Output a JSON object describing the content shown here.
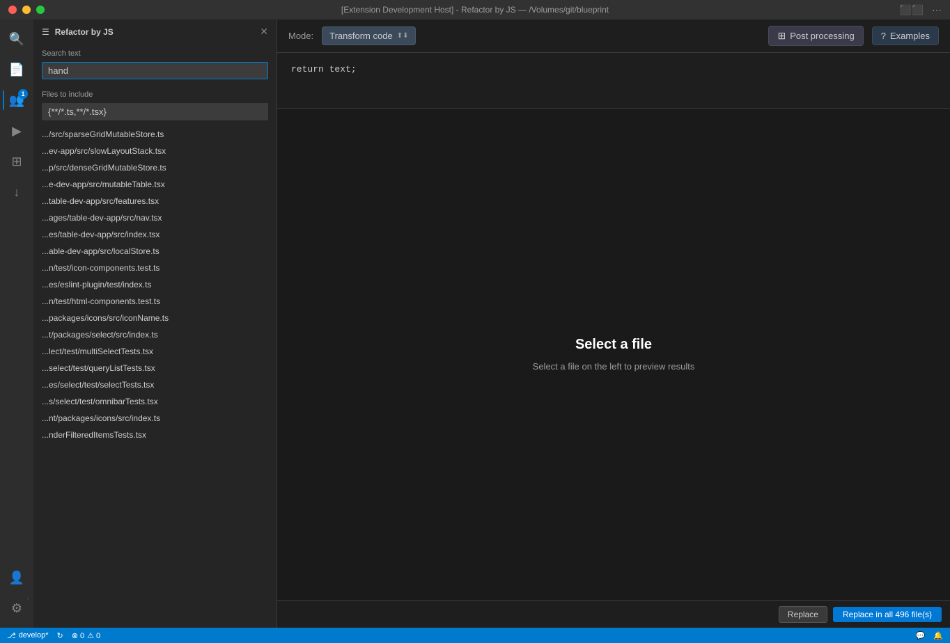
{
  "titlebar": {
    "title": "[Extension Development Host] - Refactor by JS — /Volumes/git/blueprint"
  },
  "panel": {
    "header_icon": "☰",
    "title": "Refactor by JS",
    "close_label": "✕",
    "search_label": "Search text",
    "search_value": "hand",
    "files_label": "Files to include",
    "files_value": "{**/*.ts,**/*.tsx}",
    "file_list": [
      ".../src/sparseGridMutableStore.ts",
      "...ev-app/src/slowLayoutStack.tsx",
      "...p/src/denseGridMutableStore.ts",
      "...e-dev-app/src/mutableTable.tsx",
      "...table-dev-app/src/features.tsx",
      "...ages/table-dev-app/src/nav.tsx",
      "...es/table-dev-app/src/index.tsx",
      "...able-dev-app/src/localStore.ts",
      "...n/test/icon-components.test.ts",
      "...es/eslint-plugin/test/index.ts",
      "...n/test/html-components.test.ts",
      "...packages/icons/src/iconName.ts",
      "...t/packages/select/src/index.ts",
      "...lect/test/multiSelectTests.tsx",
      "...select/test/queryListTests.tsx",
      "...es/select/test/selectTests.tsx",
      "...s/select/test/omnibarTests.tsx",
      "...nt/packages/icons/src/index.ts",
      "...nderFilteredItemsTests.tsx"
    ]
  },
  "toolbar": {
    "mode_label": "Mode:",
    "mode_value": "Transform code",
    "mode_arrow": "⬆⬇",
    "post_processing_label": "Post processing",
    "examples_label": "Examples"
  },
  "code": {
    "content": "return text;"
  },
  "preview": {
    "title": "Select a file",
    "subtitle": "Select a file on the left to preview results"
  },
  "bottom_bar": {
    "replace_label": "Replace",
    "replace_all_label": "Replace in all 496 file(s)"
  },
  "status_bar": {
    "branch": "develop*",
    "sync_icon": "↻",
    "errors": "⊗ 0",
    "warnings": "⚠ 0",
    "right_icons": [
      "💬",
      "🔔"
    ]
  },
  "activity": {
    "items": [
      {
        "icon": "🔍",
        "name": "search",
        "active": false
      },
      {
        "icon": "📄",
        "name": "explorer",
        "active": false
      },
      {
        "icon": "👥",
        "name": "source-control",
        "active": true,
        "badge": "1"
      },
      {
        "icon": "▶",
        "name": "run",
        "active": false
      },
      {
        "icon": "⊞",
        "name": "extensions",
        "active": false
      },
      {
        "icon": "↓",
        "name": "history",
        "active": false
      }
    ],
    "bottom_items": [
      {
        "icon": "👤",
        "name": "account"
      },
      {
        "icon": "⚙",
        "name": "settings",
        "badge_icon": "↑"
      }
    ]
  }
}
